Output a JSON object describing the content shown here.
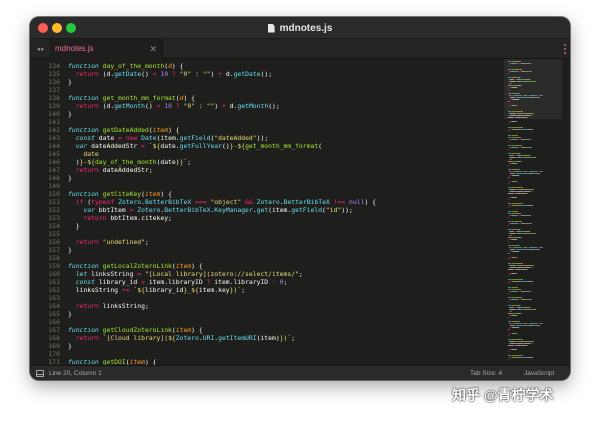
{
  "window": {
    "title": "mdnotes.js"
  },
  "tabs": [
    {
      "label": "mdnotes.js"
    }
  ],
  "status": {
    "position": "Line 20, Column 1",
    "tab_size": "Tab Size: 4",
    "syntax": "JavaScript"
  },
  "watermark": "知乎 @青柠学术",
  "colors": {
    "keyword": "#f92672",
    "storage": "#66d9ef",
    "function": "#a6e22e",
    "parameter": "#fd971f",
    "string": "#e6db74",
    "number": "#ae81ff",
    "plain": "#f8f8f2",
    "line_number": "#75715e",
    "background": "#1e1f1c"
  },
  "icons": {
    "close": "close-icon",
    "document": "document-icon",
    "nav": "nav-arrows-icon",
    "panel": "panel-toggle-icon",
    "menu": "tab-menu-icon"
  },
  "editor": {
    "lines": [
      {
        "n": "134",
        "tokens": [
          [
            "storage",
            "function"
          ],
          [
            "plain",
            " "
          ],
          [
            "fn",
            "day_of_the_month"
          ],
          [
            "plain",
            "("
          ],
          [
            "param",
            "d"
          ],
          [
            "plain",
            ") {"
          ]
        ]
      },
      {
        "n": "135",
        "tokens": [
          [
            "plain",
            "  "
          ],
          [
            "keyword",
            "return"
          ],
          [
            "plain",
            " (d."
          ],
          [
            "builtin",
            "getDate"
          ],
          [
            "plain",
            "() "
          ],
          [
            "keyword",
            "<"
          ],
          [
            "plain",
            " "
          ],
          [
            "number",
            "10"
          ],
          [
            "plain",
            " "
          ],
          [
            "keyword",
            "?"
          ],
          [
            "plain",
            " "
          ],
          [
            "string",
            "\"0\""
          ],
          [
            "plain",
            " : "
          ],
          [
            "string",
            "\"\""
          ],
          [
            "plain",
            ") "
          ],
          [
            "keyword",
            "+"
          ],
          [
            "plain",
            " d."
          ],
          [
            "builtin",
            "getDate"
          ],
          [
            "plain",
            "();"
          ]
        ]
      },
      {
        "n": "136",
        "tokens": [
          [
            "plain",
            "}"
          ]
        ]
      },
      {
        "n": "137",
        "tokens": []
      },
      {
        "n": "138",
        "tokens": [
          [
            "storage",
            "function"
          ],
          [
            "plain",
            " "
          ],
          [
            "fn",
            "get_month_mm_format"
          ],
          [
            "plain",
            "("
          ],
          [
            "param",
            "d"
          ],
          [
            "plain",
            ") {"
          ]
        ]
      },
      {
        "n": "139",
        "tokens": [
          [
            "plain",
            "  "
          ],
          [
            "keyword",
            "return"
          ],
          [
            "plain",
            " (d."
          ],
          [
            "builtin",
            "getMonth"
          ],
          [
            "plain",
            "() "
          ],
          [
            "keyword",
            "<"
          ],
          [
            "plain",
            " "
          ],
          [
            "number",
            "10"
          ],
          [
            "plain",
            " "
          ],
          [
            "keyword",
            "?"
          ],
          [
            "plain",
            " "
          ],
          [
            "string",
            "\"0\""
          ],
          [
            "plain",
            " : "
          ],
          [
            "string",
            "\"\""
          ],
          [
            "plain",
            ") "
          ],
          [
            "keyword",
            "+"
          ],
          [
            "plain",
            " d."
          ],
          [
            "builtin",
            "getMonth"
          ],
          [
            "plain",
            "();"
          ]
        ]
      },
      {
        "n": "140",
        "tokens": [
          [
            "plain",
            "}"
          ]
        ]
      },
      {
        "n": "141",
        "tokens": []
      },
      {
        "n": "142",
        "tokens": [
          [
            "storage",
            "function"
          ],
          [
            "plain",
            " "
          ],
          [
            "fn",
            "getDateAdded"
          ],
          [
            "plain",
            "("
          ],
          [
            "param",
            "item"
          ],
          [
            "plain",
            ") {"
          ]
        ]
      },
      {
        "n": "143",
        "tokens": [
          [
            "plain",
            "  "
          ],
          [
            "storage",
            "const"
          ],
          [
            "plain",
            " date "
          ],
          [
            "keyword",
            "="
          ],
          [
            "plain",
            " "
          ],
          [
            "keyword",
            "new"
          ],
          [
            "plain",
            " "
          ],
          [
            "class",
            "Date"
          ],
          [
            "plain",
            "(item."
          ],
          [
            "builtin",
            "getField"
          ],
          [
            "plain",
            "("
          ],
          [
            "string",
            "\"dateAdded\""
          ],
          [
            "plain",
            "));"
          ]
        ]
      },
      {
        "n": "144",
        "tokens": [
          [
            "plain",
            "  "
          ],
          [
            "storage",
            "var"
          ],
          [
            "plain",
            " dateAddedStr "
          ],
          [
            "keyword",
            "="
          ],
          [
            "plain",
            " "
          ],
          [
            "string",
            "`${"
          ],
          [
            "plain",
            "date."
          ],
          [
            "builtin",
            "getFullYear"
          ],
          [
            "plain",
            "()"
          ],
          [
            "string",
            "}-${"
          ],
          [
            "fn",
            "get_month_mm_format"
          ],
          [
            "plain",
            "("
          ]
        ]
      },
      {
        "n": "145",
        "tokens": [
          [
            "plain",
            "    "
          ],
          [
            "string",
            "date"
          ]
        ]
      },
      {
        "n": "146",
        "tokens": [
          [
            "plain",
            "  )"
          ],
          [
            "string",
            "}-${"
          ],
          [
            "fn",
            "day_of_the_month"
          ],
          [
            "plain",
            "(date)"
          ],
          [
            "string",
            "}`"
          ],
          [
            "plain",
            ";"
          ]
        ]
      },
      {
        "n": "147",
        "tokens": [
          [
            "plain",
            "  "
          ],
          [
            "keyword",
            "return"
          ],
          [
            "plain",
            " dateAddedStr;"
          ]
        ]
      },
      {
        "n": "148",
        "tokens": [
          [
            "plain",
            "}"
          ]
        ]
      },
      {
        "n": "149",
        "tokens": []
      },
      {
        "n": "150",
        "tokens": [
          [
            "storage",
            "function"
          ],
          [
            "plain",
            " "
          ],
          [
            "fn",
            "getCiteKey"
          ],
          [
            "plain",
            "("
          ],
          [
            "param",
            "item"
          ],
          [
            "plain",
            ") {"
          ]
        ]
      },
      {
        "n": "151",
        "tokens": [
          [
            "plain",
            "  "
          ],
          [
            "keyword",
            "if"
          ],
          [
            "plain",
            " ("
          ],
          [
            "keyword",
            "typeof"
          ],
          [
            "plain",
            " "
          ],
          [
            "class",
            "Zotero"
          ],
          [
            "plain",
            "."
          ],
          [
            "class",
            "BetterBibTeX"
          ],
          [
            "plain",
            " "
          ],
          [
            "keyword",
            "==="
          ],
          [
            "plain",
            " "
          ],
          [
            "string",
            "\"object\""
          ],
          [
            "plain",
            " "
          ],
          [
            "keyword",
            "&&"
          ],
          [
            "plain",
            " "
          ],
          [
            "class",
            "Zotero"
          ],
          [
            "plain",
            "."
          ],
          [
            "class",
            "BetterBibTeX"
          ],
          [
            "plain",
            " "
          ],
          [
            "keyword",
            "!=="
          ],
          [
            "plain",
            " "
          ],
          [
            "number",
            "null"
          ],
          [
            "plain",
            ") {"
          ]
        ]
      },
      {
        "n": "152",
        "tokens": [
          [
            "plain",
            "    "
          ],
          [
            "storage",
            "var"
          ],
          [
            "plain",
            " bbtItem "
          ],
          [
            "keyword",
            "="
          ],
          [
            "plain",
            " "
          ],
          [
            "class",
            "Zotero"
          ],
          [
            "plain",
            "."
          ],
          [
            "class",
            "BetterBibTeX"
          ],
          [
            "plain",
            "."
          ],
          [
            "class",
            "KeyManager"
          ],
          [
            "plain",
            "."
          ],
          [
            "builtin",
            "get"
          ],
          [
            "plain",
            "(item."
          ],
          [
            "builtin",
            "getField"
          ],
          [
            "plain",
            "("
          ],
          [
            "string",
            "\"id\""
          ],
          [
            "plain",
            "));"
          ]
        ]
      },
      {
        "n": "153",
        "tokens": [
          [
            "plain",
            "    "
          ],
          [
            "keyword",
            "return"
          ],
          [
            "plain",
            " bbtItem.citekey;"
          ]
        ]
      },
      {
        "n": "154",
        "tokens": [
          [
            "plain",
            "  }"
          ]
        ]
      },
      {
        "n": "155",
        "tokens": []
      },
      {
        "n": "156",
        "tokens": [
          [
            "plain",
            "  "
          ],
          [
            "keyword",
            "return"
          ],
          [
            "plain",
            " "
          ],
          [
            "string",
            "\"undefined\""
          ],
          [
            "plain",
            ";"
          ]
        ]
      },
      {
        "n": "157",
        "tokens": [
          [
            "plain",
            "}"
          ]
        ]
      },
      {
        "n": "158",
        "tokens": []
      },
      {
        "n": "159",
        "tokens": [
          [
            "storage",
            "function"
          ],
          [
            "plain",
            " "
          ],
          [
            "fn",
            "getLocalZoteroLink"
          ],
          [
            "plain",
            "("
          ],
          [
            "param",
            "item"
          ],
          [
            "plain",
            ") {"
          ]
        ]
      },
      {
        "n": "160",
        "tokens": [
          [
            "plain",
            "  "
          ],
          [
            "storage",
            "let"
          ],
          [
            "plain",
            " linksString "
          ],
          [
            "keyword",
            "="
          ],
          [
            "plain",
            " "
          ],
          [
            "string",
            "\"[Local library](zotero://select/items/\""
          ],
          [
            "plain",
            ";"
          ]
        ]
      },
      {
        "n": "161",
        "tokens": [
          [
            "plain",
            "  "
          ],
          [
            "storage",
            "const"
          ],
          [
            "plain",
            " library_id "
          ],
          [
            "keyword",
            "="
          ],
          [
            "plain",
            " item.libraryID "
          ],
          [
            "keyword",
            "?"
          ],
          [
            "plain",
            " item.libraryID "
          ],
          [
            "keyword",
            ":"
          ],
          [
            "plain",
            " "
          ],
          [
            "number",
            "0"
          ],
          [
            "plain",
            ";"
          ]
        ]
      },
      {
        "n": "162",
        "tokens": [
          [
            "plain",
            "  linksString "
          ],
          [
            "keyword",
            "+="
          ],
          [
            "plain",
            " "
          ],
          [
            "string",
            "`${"
          ],
          [
            "plain",
            "library_id"
          ],
          [
            "string",
            "}_${"
          ],
          [
            "plain",
            "item.key"
          ],
          [
            "string",
            "})`"
          ],
          [
            "plain",
            ";"
          ]
        ]
      },
      {
        "n": "163",
        "tokens": []
      },
      {
        "n": "164",
        "tokens": [
          [
            "plain",
            "  "
          ],
          [
            "keyword",
            "return"
          ],
          [
            "plain",
            " linksString;"
          ]
        ]
      },
      {
        "n": "165",
        "tokens": [
          [
            "plain",
            "}"
          ]
        ]
      },
      {
        "n": "166",
        "tokens": []
      },
      {
        "n": "167",
        "tokens": [
          [
            "storage",
            "function"
          ],
          [
            "plain",
            " "
          ],
          [
            "fn",
            "getCloudZoteroLink"
          ],
          [
            "plain",
            "("
          ],
          [
            "param",
            "item"
          ],
          [
            "plain",
            ") {"
          ]
        ]
      },
      {
        "n": "168",
        "tokens": [
          [
            "plain",
            "  "
          ],
          [
            "keyword",
            "return"
          ],
          [
            "plain",
            " "
          ],
          [
            "string",
            "`[Cloud library](${"
          ],
          [
            "class",
            "Zotero"
          ],
          [
            "plain",
            "."
          ],
          [
            "class",
            "URI"
          ],
          [
            "plain",
            "."
          ],
          [
            "builtin",
            "getItemURI"
          ],
          [
            "plain",
            "(item)"
          ],
          [
            "string",
            "})`"
          ],
          [
            "plain",
            ";"
          ]
        ]
      },
      {
        "n": "169",
        "tokens": [
          [
            "plain",
            "}"
          ]
        ]
      },
      {
        "n": "170",
        "tokens": []
      },
      {
        "n": "171",
        "tokens": [
          [
            "storage",
            "function"
          ],
          [
            "plain",
            " "
          ],
          [
            "fn",
            "getDOI"
          ],
          [
            "plain",
            "("
          ],
          [
            "param",
            "item"
          ],
          [
            "plain",
            ") {"
          ]
        ]
      }
    ]
  }
}
